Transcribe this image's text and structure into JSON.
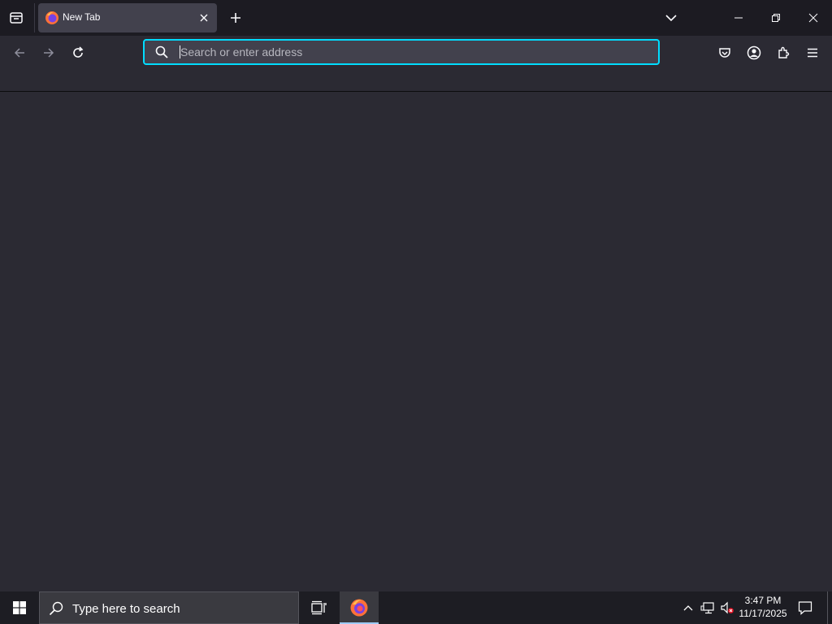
{
  "browser": {
    "tabs": [
      {
        "title": "New Tab",
        "active": true,
        "favicon": "firefox-icon"
      }
    ],
    "urlbar": {
      "placeholder": "Search or enter address",
      "value": ""
    },
    "toolbar_icons": [
      "back-arrow-icon",
      "forward-arrow-icon",
      "reload-icon",
      "pocket-icon",
      "account-icon",
      "extensions-icon",
      "hamburger-menu-icon"
    ],
    "colors": {
      "tabstrip": "#1c1b22",
      "toolbar": "#2b2a33",
      "active_tab": "#42414d",
      "focus_ring": "#00ddff"
    }
  },
  "taskbar": {
    "search_placeholder": "Type here to search",
    "pinned": [
      "task-view-icon",
      "firefox-icon"
    ],
    "clock": {
      "time": "3:47 PM",
      "date": "11/17/2025"
    },
    "tray_icons": [
      "chevron-up-icon",
      "network-icon",
      "volume-muted-icon"
    ]
  }
}
